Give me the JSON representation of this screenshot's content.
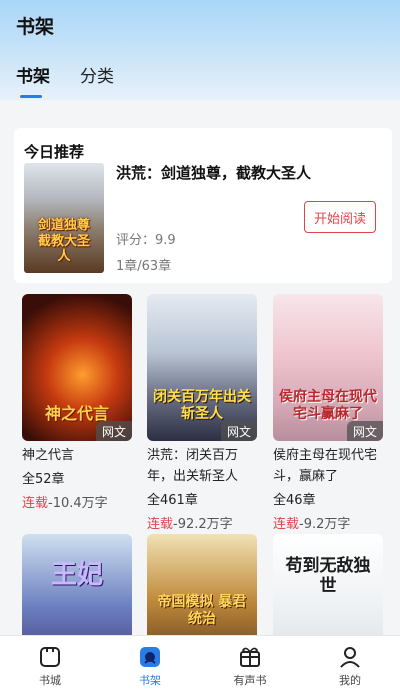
{
  "header": {
    "title": "书架",
    "tabs": [
      {
        "label": "书架",
        "active": true
      },
      {
        "label": "分类",
        "active": false
      }
    ]
  },
  "recommend": {
    "heading": "今日推荐",
    "title": "洪荒：剑道独尊，截教大圣人",
    "score": "评分：9.9",
    "progress": "1章/63章",
    "button": "开始阅读",
    "cover_text": "剑道独尊截教大圣人"
  },
  "books": [
    {
      "name": "神之代言",
      "chapters": "全52章",
      "status": "连载",
      "words": "-10.4万字",
      "badge": "网文",
      "cover_text": "神之代言"
    },
    {
      "name": "洪荒：闭关百万年，出关斩圣人",
      "chapters": "全461章",
      "status": "连载",
      "words": "-92.2万字",
      "badge": "网文",
      "cover_text": "闭关百万年出关斩圣人"
    },
    {
      "name": "侯府主母在现代宅斗，赢麻了",
      "chapters": "全46章",
      "status": "连载",
      "words": "-9.2万字",
      "badge": "网文",
      "cover_text": "侯府主母在现代宅斗赢麻了"
    },
    {
      "name": "",
      "chapters": "",
      "status": "",
      "words": "",
      "badge": "",
      "cover_text": "王妃"
    },
    {
      "name": "",
      "chapters": "",
      "status": "",
      "words": "",
      "badge": "",
      "cover_text": "帝国模拟 暴君统治"
    },
    {
      "name": "",
      "chapters": "",
      "status": "",
      "words": "",
      "badge": "",
      "cover_text": "苟到无敌独世"
    }
  ],
  "nav": [
    {
      "label": "书城",
      "icon": "bookstore-icon",
      "active": false
    },
    {
      "label": "书架",
      "icon": "bookshelf-icon",
      "active": true
    },
    {
      "label": "有声书",
      "icon": "audiobook-icon",
      "active": false
    },
    {
      "label": "我的",
      "icon": "profile-icon",
      "active": false
    }
  ],
  "colors": {
    "accent": "#2a7be4",
    "serial": "#e0454a"
  }
}
